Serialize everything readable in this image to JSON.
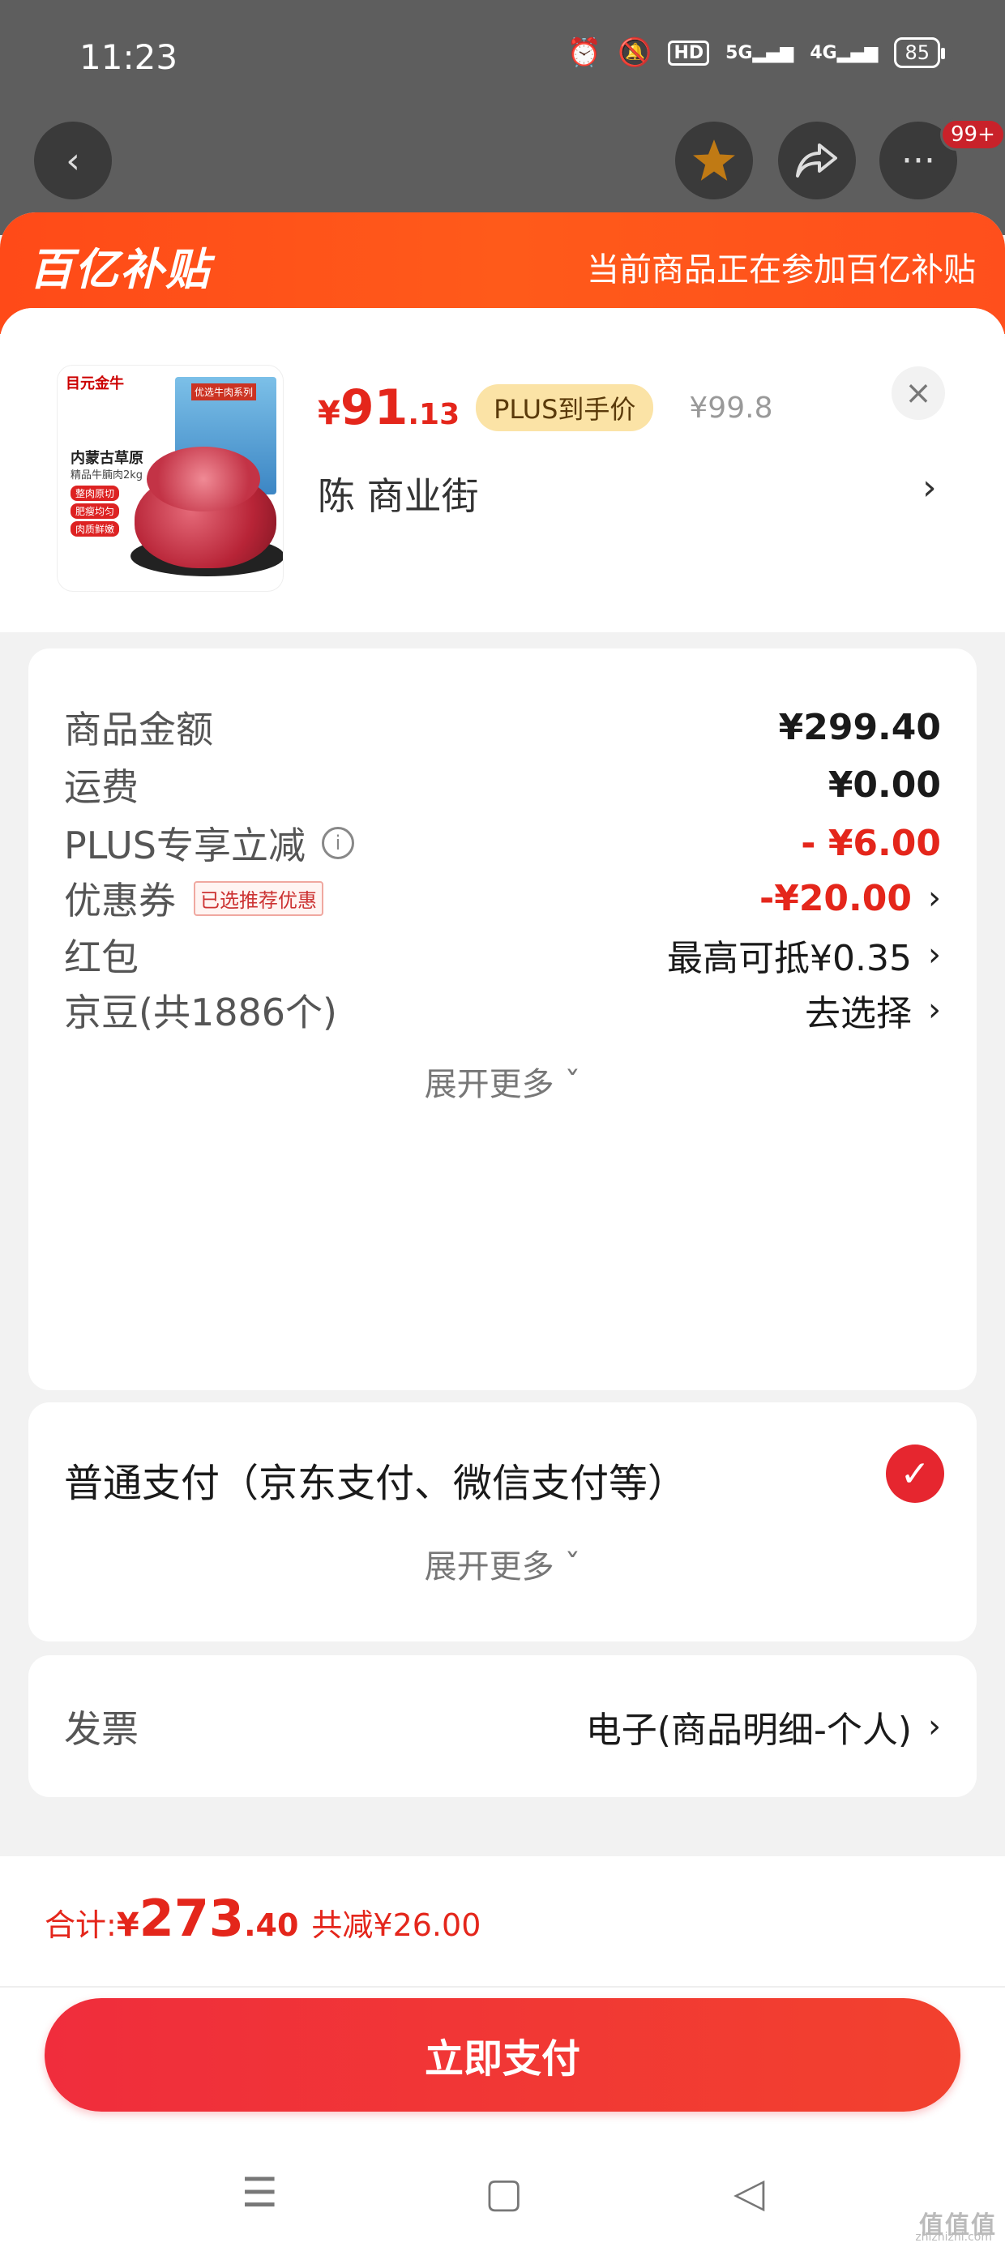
{
  "status_bar": {
    "time": "11:23",
    "network1": "5G",
    "network2": "4G",
    "hd": "HD",
    "battery": "85"
  },
  "header": {
    "badge_count": "99+"
  },
  "banner": {
    "logo": "百亿补贴",
    "text": "当前商品正在参加百亿补贴"
  },
  "product": {
    "brand": "目元金牛",
    "thumb_title": "内蒙古草原",
    "thumb_subtitle": "精品牛腩肉2kg",
    "thumb_box_label": "优选牛肉系列",
    "thumb_tags": [
      "整肉原切",
      "肥瘦均匀",
      "肉质鲜嫩"
    ],
    "price_currency": "¥",
    "price_int": "91",
    "price_dec": ".13",
    "plus_tag": "PLUS到手价",
    "original_price": "¥99.8",
    "address": "陈  商业街"
  },
  "summary": {
    "rows": [
      {
        "label": "商品金额",
        "value": "¥299.40"
      },
      {
        "label": "运费",
        "value": "¥0.00"
      },
      {
        "label": "PLUS专享立减",
        "value": "- ¥6.00"
      },
      {
        "label": "优惠券",
        "tag": "已选推荐优惠",
        "value": "-¥20.00"
      },
      {
        "label": "红包",
        "value": "最高可抵¥0.35"
      },
      {
        "label": "京豆(共1886个)",
        "value": "去选择"
      }
    ],
    "expand": "展开更多"
  },
  "payment": {
    "label": "普通支付（京东支付、微信支付等）",
    "expand": "展开更多"
  },
  "invoice": {
    "label": "发票",
    "value": "电子(商品明细-个人)"
  },
  "footer": {
    "total_label": "合计: ",
    "total_currency": "¥",
    "total_int": "273",
    "total_dec": ".40",
    "total_saved": "共减¥26.00",
    "pay_button": "立即支付"
  },
  "watermark": {
    "text": "值值值",
    "sub": "zhizhizhi.com"
  },
  "colors": {
    "accent": "#e4261b",
    "banner": "#ff4a18",
    "plus_tag_bg": "#fbe3a6"
  }
}
